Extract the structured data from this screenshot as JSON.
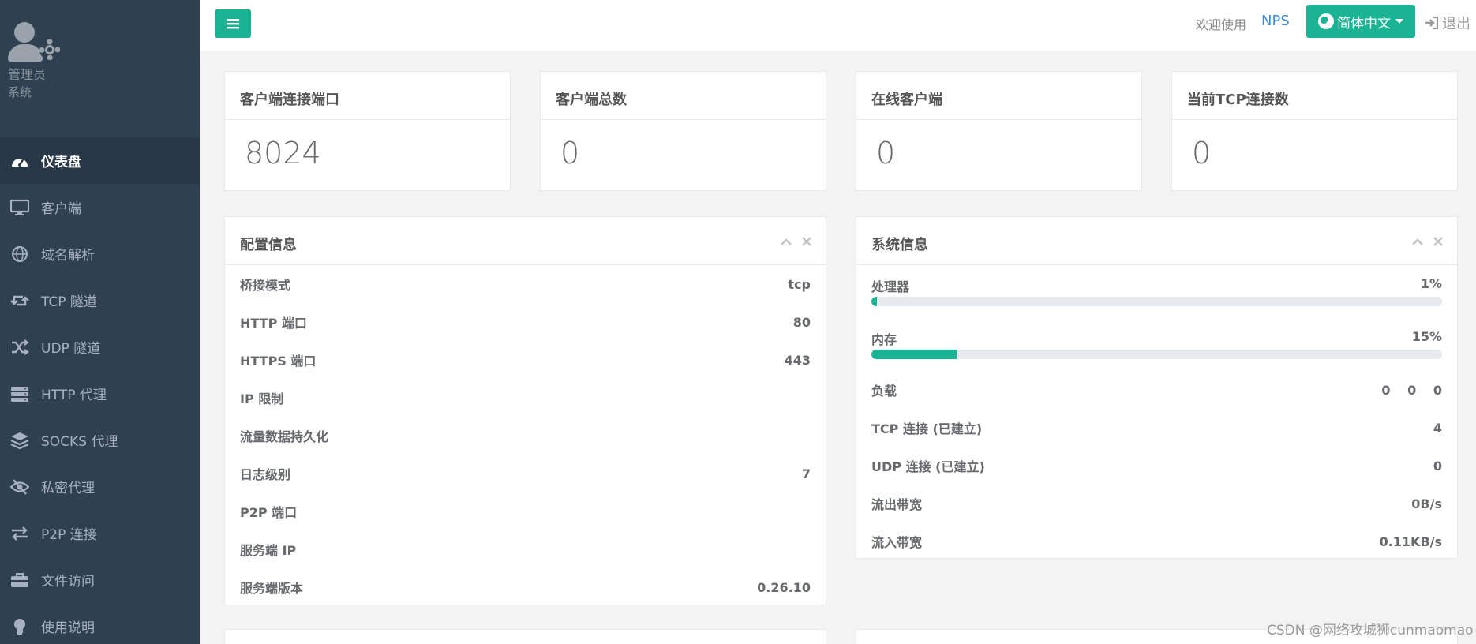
{
  "profile": {
    "name": "管理员",
    "role": "系统"
  },
  "nav": [
    {
      "label": "仪表盘",
      "icon": "dashboard-icon",
      "active": true
    },
    {
      "label": "客户端",
      "icon": "monitor-icon"
    },
    {
      "label": "域名解析",
      "icon": "globe-icon"
    },
    {
      "label": "TCP 隧道",
      "icon": "retweet-icon"
    },
    {
      "label": "UDP 隧道",
      "icon": "random-icon"
    },
    {
      "label": "HTTP 代理",
      "icon": "server-icon"
    },
    {
      "label": "SOCKS 代理",
      "icon": "layers-icon"
    },
    {
      "label": "私密代理",
      "icon": "eye-slash-icon"
    },
    {
      "label": "P2P 连接",
      "icon": "exchange-icon"
    },
    {
      "label": "文件访问",
      "icon": "briefcase-icon"
    },
    {
      "label": "使用说明",
      "icon": "lightbulb-icon"
    }
  ],
  "topbar": {
    "welcome": "欢迎使用",
    "brand": "NPS",
    "language": "简体中文",
    "logout": "退出"
  },
  "stats": [
    {
      "title": "客户端连接端口",
      "value": "8024"
    },
    {
      "title": "客户端总数",
      "value": "0"
    },
    {
      "title": "在线客户端",
      "value": "0"
    },
    {
      "title": "当前TCP连接数",
      "value": "0"
    }
  ],
  "config_panel": {
    "title": "配置信息",
    "rows": [
      {
        "label": "桥接模式",
        "value": "tcp"
      },
      {
        "label": "HTTP 端口",
        "value": "80"
      },
      {
        "label": "HTTPS 端口",
        "value": "443"
      },
      {
        "label": "IP 限制",
        "value": ""
      },
      {
        "label": "流量数据持久化",
        "value": ""
      },
      {
        "label": "日志级别",
        "value": "7"
      },
      {
        "label": "P2P 端口",
        "value": ""
      },
      {
        "label": "服务端 IP",
        "value": ""
      },
      {
        "label": "服务端版本",
        "value": "0.26.10"
      }
    ]
  },
  "system_panel": {
    "title": "系统信息",
    "cpu": {
      "label": "处理器",
      "value": "1%",
      "percent": 1
    },
    "memory": {
      "label": "内存",
      "value": "15%",
      "percent": 15
    },
    "load": {
      "label": "负载",
      "values": [
        "0",
        "0",
        "0"
      ]
    },
    "rows": [
      {
        "label": "TCP 连接 (已建立)",
        "value": "4"
      },
      {
        "label": "UDP 连接 (已建立)",
        "value": "0"
      },
      {
        "label": "流出带宽",
        "value": "0B/s"
      },
      {
        "label": "流入带宽",
        "value": "0.11KB/s"
      }
    ]
  },
  "watermark": "CSDN @网络攻城狮cunmaomao",
  "colors": {
    "sidebar": "#2f4050",
    "accent": "#1ab394",
    "link": "#3d8fd6"
  }
}
